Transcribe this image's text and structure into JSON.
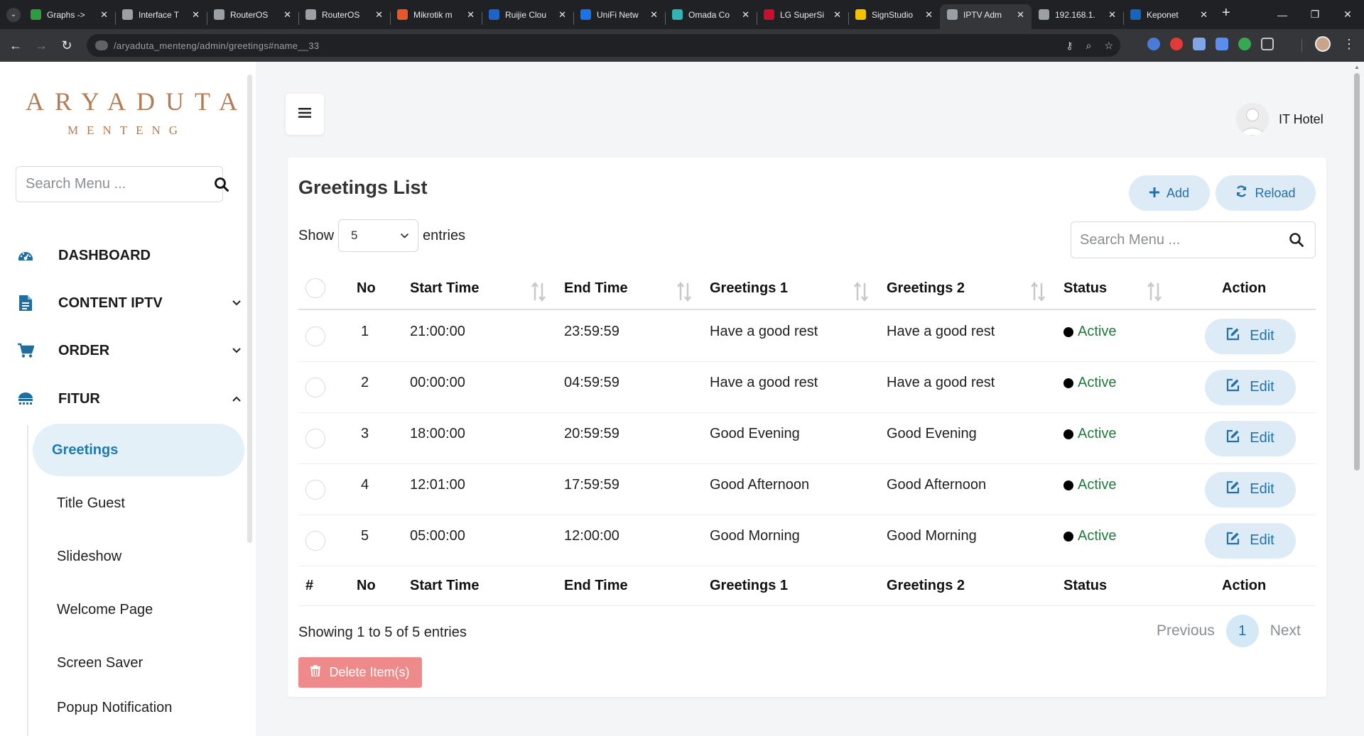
{
  "browser": {
    "tabs": [
      {
        "title": "Graphs ->",
        "color": "#2e9c3f",
        "active": false
      },
      {
        "title": "Interface T",
        "color": "#9aa0a6",
        "active": false
      },
      {
        "title": "RouterOS",
        "color": "#9aa0a6",
        "active": false
      },
      {
        "title": "RouterOS",
        "color": "#9aa0a6",
        "active": false
      },
      {
        "title": "Mikrotik m",
        "color": "#e8572a",
        "active": false
      },
      {
        "title": "Ruijie Clou",
        "color": "#1e64c8",
        "active": false
      },
      {
        "title": "UniFi Netw",
        "color": "#1a73e8",
        "active": false
      },
      {
        "title": "Omada Co",
        "color": "#32b4b4",
        "active": false
      },
      {
        "title": "LG SuperSi",
        "color": "#c8102e",
        "active": false
      },
      {
        "title": "SignStudio",
        "color": "#f2c100",
        "active": false
      },
      {
        "title": "IPTV Adm",
        "color": "#9aa0a6",
        "active": true
      },
      {
        "title": "192.168.1.",
        "color": "#9aa0a6",
        "active": false
      },
      {
        "title": "Keponet",
        "color": "#1565c0",
        "active": false
      }
    ],
    "url": "/aryaduta_menteng/admin/greetings#name__33"
  },
  "sidebar": {
    "logo_main": "ARYADUTA",
    "logo_sub": "MENTENG",
    "search_placeholder": "Search Menu ...",
    "menu": [
      {
        "label": "DASHBOARD",
        "icon": "dashboard-icon",
        "has_chevron": false
      },
      {
        "label": "CONTENT IPTV",
        "icon": "document-icon",
        "has_chevron": true,
        "expanded": false
      },
      {
        "label": "ORDER",
        "icon": "cart-icon",
        "has_chevron": true,
        "expanded": false
      },
      {
        "label": "FITUR",
        "icon": "features-icon",
        "has_chevron": true,
        "expanded": true
      }
    ],
    "submenu": [
      {
        "label": "Greetings",
        "active": true
      },
      {
        "label": "Title Guest",
        "active": false
      },
      {
        "label": "Slideshow",
        "active": false
      },
      {
        "label": "Welcome Page",
        "active": false
      },
      {
        "label": "Screen Saver",
        "active": false
      },
      {
        "label": "Popup Notification",
        "active": false
      }
    ]
  },
  "header": {
    "user_name": "IT Hotel"
  },
  "main": {
    "title": "Greetings List",
    "add_label": "Add",
    "reload_label": "Reload",
    "show_label": "Show",
    "entries_label": "entries",
    "page_size": "5",
    "search_placeholder": "Search Menu ...",
    "columns": [
      "No",
      "Start Time",
      "End Time",
      "Greetings 1",
      "Greetings 2",
      "Status",
      "Action"
    ],
    "footer_columns": [
      "#",
      "No",
      "Start Time",
      "End Time",
      "Greetings 1",
      "Greetings 2",
      "Status",
      "Action"
    ],
    "rows": [
      {
        "no": "1",
        "start": "21:00:00",
        "end": "23:59:59",
        "g1": "Have a good rest",
        "g2": "Have a good rest",
        "status": "Active",
        "action": "Edit"
      },
      {
        "no": "2",
        "start": "00:00:00",
        "end": "04:59:59",
        "g1": "Have a good rest",
        "g2": "Have a good rest",
        "status": "Active",
        "action": "Edit"
      },
      {
        "no": "3",
        "start": "18:00:00",
        "end": "20:59:59",
        "g1": "Good Evening",
        "g2": "Good Evening",
        "status": "Active",
        "action": "Edit"
      },
      {
        "no": "4",
        "start": "12:01:00",
        "end": "17:59:59",
        "g1": "Good Afternoon",
        "g2": "Good Afternoon",
        "status": "Active",
        "action": "Edit"
      },
      {
        "no": "5",
        "start": "05:00:00",
        "end": "12:00:00",
        "g1": "Good Morning",
        "g2": "Good Morning",
        "status": "Active",
        "action": "Edit"
      }
    ],
    "showing_text": "Showing 1 to 5 of 5 entries",
    "pagination": {
      "previous": "Previous",
      "current": "1",
      "next": "Next"
    },
    "delete_label": "Delete Item(s)"
  },
  "colors": {
    "accent": "#2271a8",
    "accent_bg": "#dcebf5",
    "brand": "#b47b53",
    "status_active": "#24783f",
    "danger": "#ef8a8a"
  }
}
